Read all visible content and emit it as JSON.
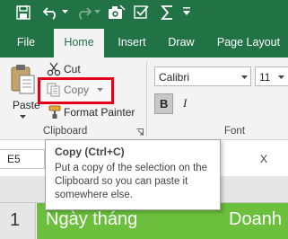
{
  "tabs": [
    {
      "label": "File"
    },
    {
      "label": "Home"
    },
    {
      "label": "Insert"
    },
    {
      "label": "Draw"
    },
    {
      "label": "Page Layout"
    }
  ],
  "clipboard": {
    "paste_label": "Paste",
    "cut_label": "Cut",
    "copy_label": "Copy",
    "format_painter_label": "Format Painter",
    "group_label": "Clipboard"
  },
  "font": {
    "font_name": "Calibri",
    "font_size": "11",
    "bold_label": "B",
    "italic_label": "I",
    "group_label": "Font"
  },
  "formula_bar": {
    "name_box": "E5",
    "fx_partial": "X"
  },
  "tooltip": {
    "title": "Copy (Ctrl+C)",
    "body": "Put a copy of the selection on the Clipboard so you can paste it somewhere else."
  },
  "sheet": {
    "row_number": "1",
    "cell_a": "Ngày tháng",
    "cell_b": "Doanh"
  },
  "colors": {
    "brand_green": "#217346",
    "header_cell_green": "#6cbf3c",
    "highlight_red": "#e3001b"
  }
}
